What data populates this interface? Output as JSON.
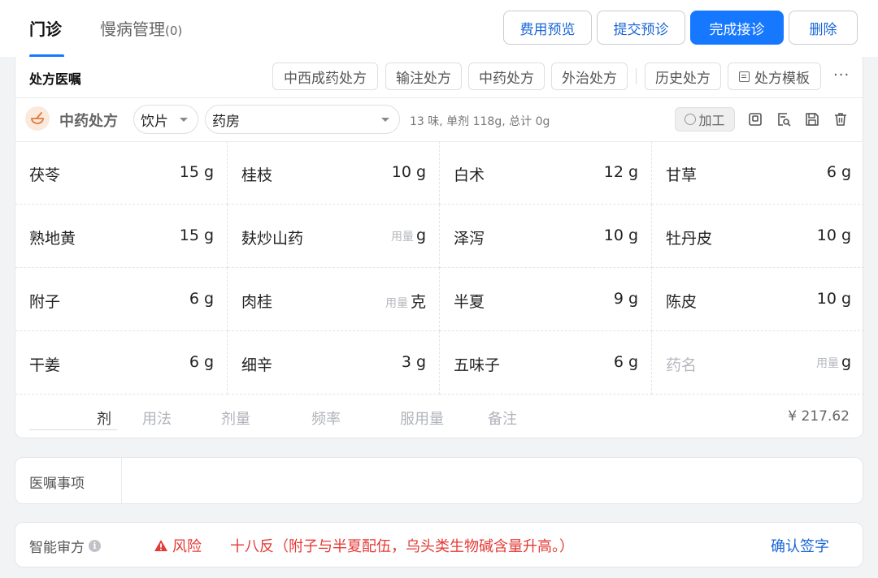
{
  "header": {
    "tabs": [
      {
        "label": "门诊",
        "active": true
      },
      {
        "label": "慢病管理",
        "count": "(0)"
      }
    ],
    "buttons": {
      "fee_preview": "费用预览",
      "submit_precheck": "提交预诊",
      "finish_visit": "完成接诊",
      "delete": "删除"
    }
  },
  "rx_card": {
    "title": "处方医嘱",
    "types": [
      "中西成药处方",
      "输注处方",
      "中药处方",
      "外治处方"
    ],
    "history": "历史处方",
    "template": "处方模板",
    "more": "···"
  },
  "toolbar": {
    "label": "中药处方",
    "form_select": "饮片",
    "pharmacy_select": "药房",
    "summary": "13 味, 单剂 118g, 总计 0g",
    "process": "加工"
  },
  "herbs": [
    {
      "name": "茯苓",
      "dose": "15",
      "unit": "g"
    },
    {
      "name": "桂枝",
      "dose": "10",
      "unit": "g"
    },
    {
      "name": "白术",
      "dose": "12",
      "unit": "g"
    },
    {
      "name": "甘草",
      "dose": "6",
      "unit": "g"
    },
    {
      "name": "熟地黄",
      "dose": "15",
      "unit": "g"
    },
    {
      "name": "麸炒山药",
      "dose": "",
      "dose_placeholder": "用量",
      "unit": "g"
    },
    {
      "name": "泽泻",
      "dose": "10",
      "unit": "g"
    },
    {
      "name": "牡丹皮",
      "dose": "10",
      "unit": "g"
    },
    {
      "name": "附子",
      "dose": "6",
      "unit": "g"
    },
    {
      "name": "肉桂",
      "dose": "",
      "dose_placeholder": "用量",
      "unit": "克"
    },
    {
      "name": "半夏",
      "dose": "9",
      "unit": "g"
    },
    {
      "name": "陈皮",
      "dose": "10",
      "unit": "g"
    },
    {
      "name": "干姜",
      "dose": "6",
      "unit": "g"
    },
    {
      "name": "细辛",
      "dose": "3",
      "unit": "g"
    },
    {
      "name": "五味子",
      "dose": "6",
      "unit": "g"
    },
    {
      "name": "",
      "name_placeholder": "药名",
      "dose": "",
      "dose_placeholder": "用量",
      "unit": "g"
    }
  ],
  "usage": {
    "ji": "剂",
    "method": "用法",
    "dosage": "剂量",
    "frequency": "频率",
    "amount": "服用量",
    "remark": "备注",
    "price": "¥ 217.62"
  },
  "orders": {
    "label": "医嘱事项",
    "value": ""
  },
  "audit": {
    "label": "智能审方",
    "risk_label": "风险",
    "risk_message": "十八反（附子与半夏配伍，乌头类生物碱含量升高。）",
    "confirm": "确认签字"
  },
  "colors": {
    "primary": "#1677ff",
    "link": "#1a66d6",
    "danger": "#e53935",
    "placeholder": "#b5b8be"
  }
}
